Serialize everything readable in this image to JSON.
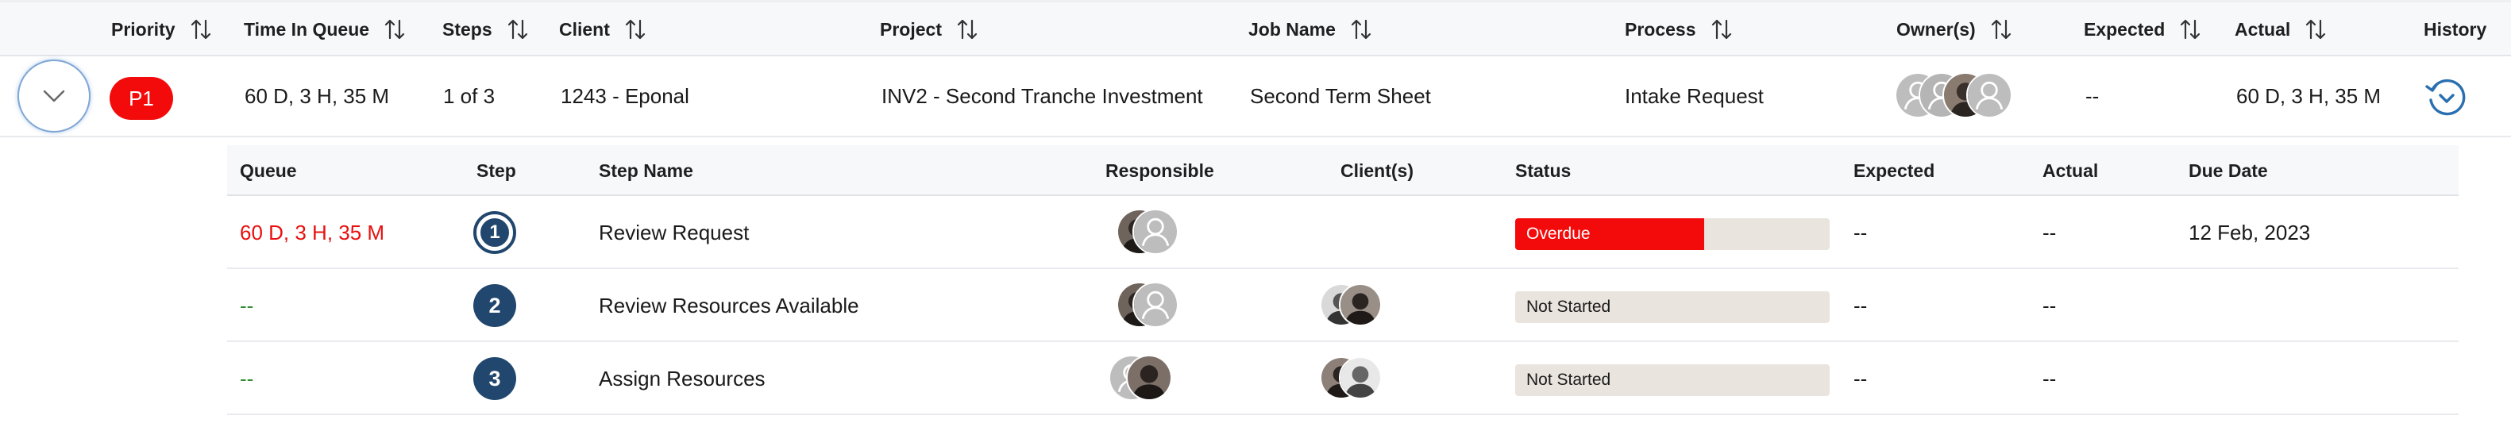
{
  "main_table": {
    "headers": {
      "priority": "Priority",
      "time_in_queue": "Time In Queue",
      "steps": "Steps",
      "client": "Client",
      "project": "Project",
      "job_name": "Job Name",
      "process": "Process",
      "owners": "Owner(s)",
      "expected": "Expected",
      "actual": "Actual",
      "history": "History"
    },
    "row": {
      "priority": "P1",
      "time_in_queue": "60 D, 3 H, 35 M",
      "steps": "1 of 3",
      "client": "1243 - Eponal",
      "project": "INV2 - Second Tranche Investment",
      "job_name": "Second Term Sheet",
      "process": "Intake Request",
      "expected": "--",
      "actual": "60 D, 3 H, 35 M"
    }
  },
  "sub_table": {
    "headers": {
      "queue": "Queue",
      "step": "Step",
      "step_name": "Step Name",
      "responsible": "Responsible",
      "clients": "Client(s)",
      "status": "Status",
      "expected": "Expected",
      "actual": "Actual",
      "due_date": "Due Date"
    },
    "rows": [
      {
        "queue": "60 D, 3 H, 35 M",
        "step": "1",
        "step_name": "Review Request",
        "status": "Overdue",
        "status_progress": 0.6,
        "expected": "--",
        "actual": "--",
        "due_date": "12 Feb, 2023"
      },
      {
        "queue": "--",
        "step": "2",
        "step_name": "Review Resources Available",
        "status": "Not Started",
        "status_progress": 0,
        "expected": "--",
        "actual": "--",
        "due_date": ""
      },
      {
        "queue": "--",
        "step": "3",
        "step_name": "Assign Resources",
        "status": "Not Started",
        "status_progress": 0,
        "expected": "--",
        "actual": "--",
        "due_date": ""
      }
    ]
  },
  "colors": {
    "priority_badge": "#f30b0b",
    "overdue_text": "#e8100f",
    "empty_queue": "#2f8b2f",
    "step_circle": "#21476e",
    "status_track": "#e9e4dd",
    "history_icon": "#2a6fb0"
  },
  "icons": {
    "expand": "chevron-down-icon",
    "sort": "sort-arrows-icon",
    "history": "history-clock-icon",
    "avatar_placeholder": "user-placeholder-icon"
  }
}
